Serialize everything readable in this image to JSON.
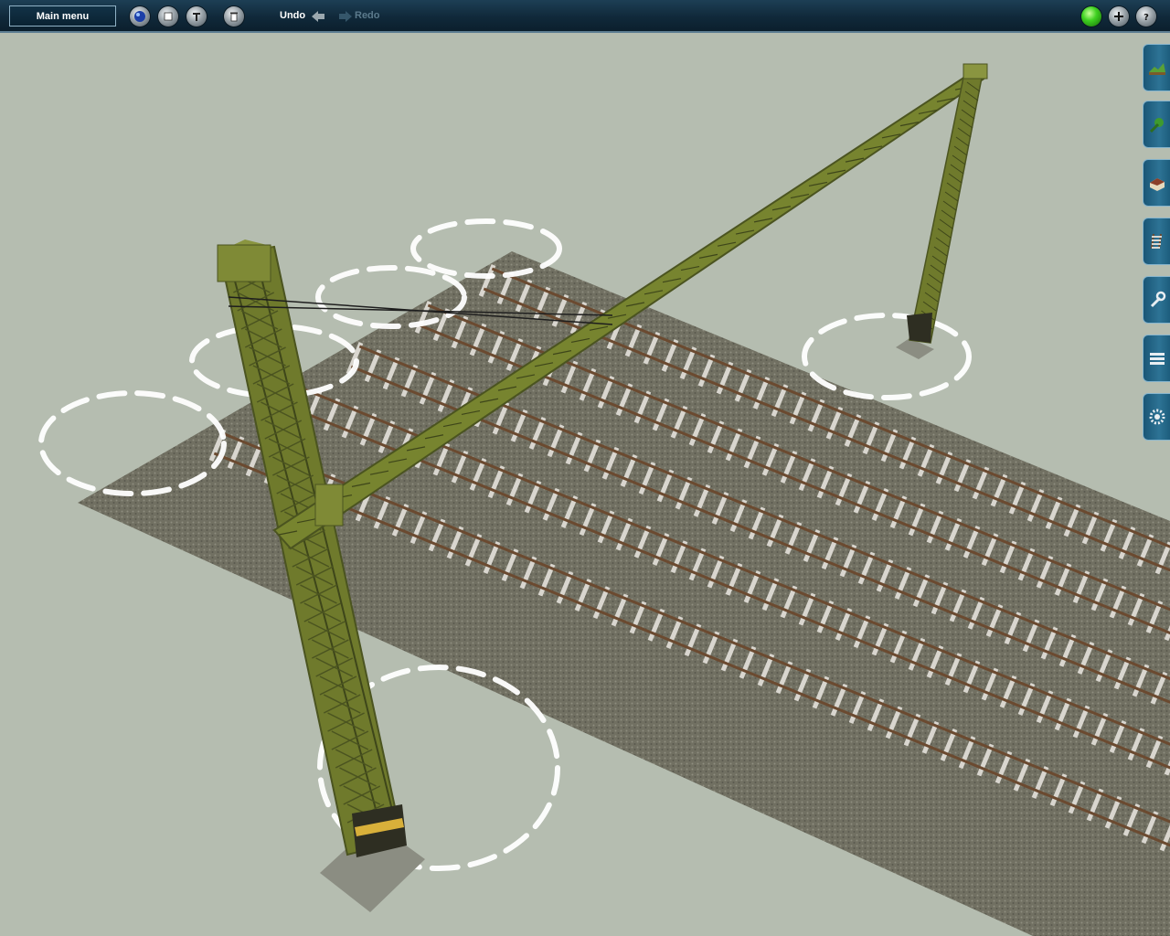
{
  "toolbar": {
    "main_menu_label": "Main menu",
    "undo_label": "Undo",
    "redo_label": "Redo",
    "left_icons": [
      "globe-icon",
      "stop-icon",
      "tools-icon",
      "trash-icon"
    ],
    "right_icons": [
      "status-light-icon",
      "add-icon",
      "help-icon"
    ]
  },
  "side_tabs": [
    {
      "name": "terrain-tab",
      "icon": "landscape-icon"
    },
    {
      "name": "paint-tab",
      "icon": "tree-brush-icon"
    },
    {
      "name": "objects-tab",
      "icon": "building-icon"
    },
    {
      "name": "track-tab",
      "icon": "track-icon"
    },
    {
      "name": "tools-tab",
      "icon": "wrench-icon"
    },
    {
      "name": "layers-tab",
      "icon": "layers-icon"
    },
    {
      "name": "settings-tab",
      "icon": "gear-icon"
    }
  ],
  "scene": {
    "description_icons": [
      "railway-tracks",
      "catenary-gantry-mast",
      "selection-rings"
    ],
    "colors": {
      "background": "#b5bdb0",
      "ballast": "#6b6a5c",
      "sleeper": "#d9d6cf",
      "rail": "#6b4a30",
      "mast": "#6f7a2c",
      "selection_ring": "#ffffff",
      "toolbar": "#10293a",
      "accent": "#2d7395"
    }
  }
}
